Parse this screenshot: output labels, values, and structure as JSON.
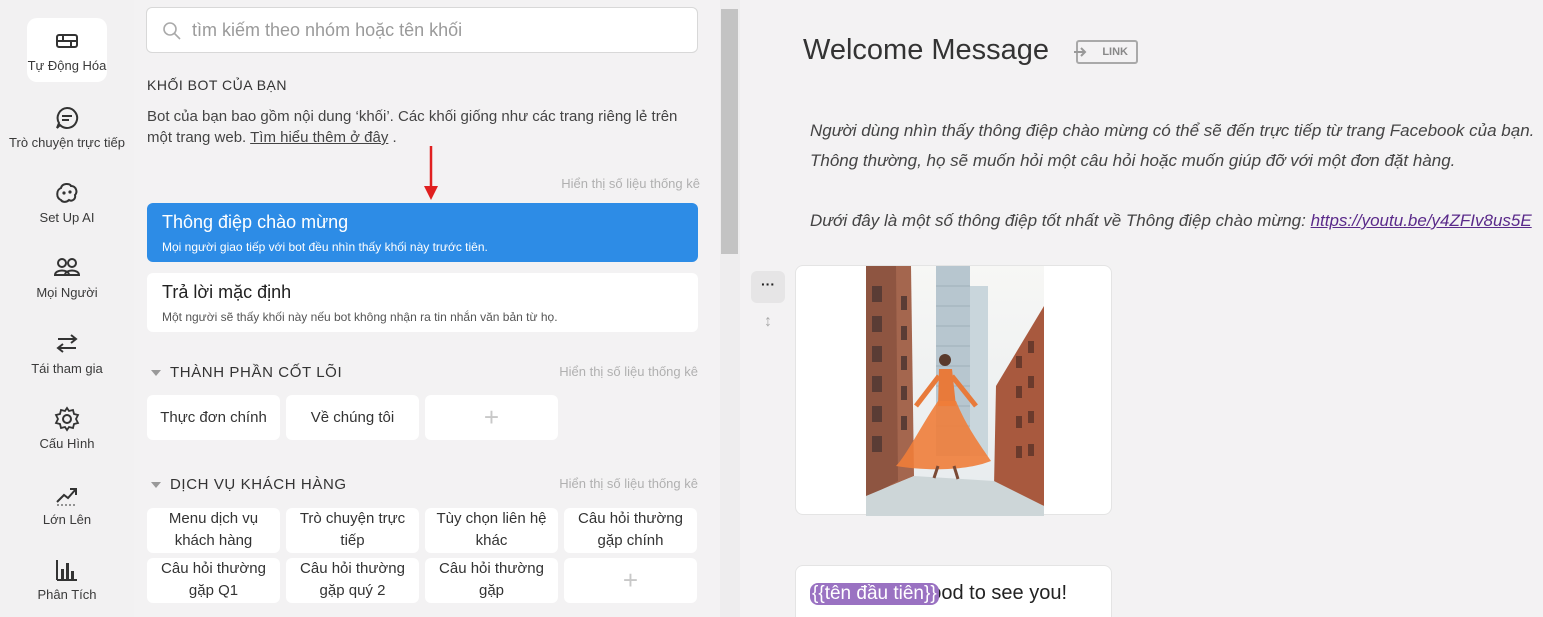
{
  "nav": {
    "items": [
      {
        "label": "Tự Động Hóa",
        "icon": "automation-icon"
      },
      {
        "label": "Trò chuyện trực tiếp",
        "icon": "chat-icon"
      },
      {
        "label": "Set Up AI",
        "icon": "ai-icon"
      },
      {
        "label": "Mọi Người",
        "icon": "people-icon"
      },
      {
        "label": "Tái tham gia",
        "icon": "reengage-icon"
      },
      {
        "label": "Cấu Hình",
        "icon": "gear-icon"
      },
      {
        "label": "Lớn Lên",
        "icon": "growth-icon"
      },
      {
        "label": "Phân Tích",
        "icon": "analytics-icon"
      }
    ]
  },
  "blocks": {
    "search_placeholder": "tìm kiếm theo nhóm hoặc tên khối",
    "heading": "KHỐI BOT CỦA BẠN",
    "desc_text": "Bot của bạn bao gồm nội dung ‘khối’. Các khối giống như các trang riêng lẻ trên một trang web.",
    "desc_link": "Tìm hiểu thêm ở đây",
    "desc_end": ".",
    "stats_label": "Hiển thị số liệu thống kê",
    "welcome": {
      "title": "Thông điệp chào mừng",
      "subtitle": "Mọi người giao tiếp với bot đều nhìn thấy khối này trước tiên."
    },
    "default_reply": {
      "title": "Trả lời mặc định",
      "subtitle": "Một người sẽ thấy khối này nếu bot không nhận ra tin nhắn văn bản từ họ."
    },
    "core": {
      "label": "THÀNH PHẦN CỐT LÕI",
      "tiles": [
        "Thực đơn chính",
        "Về chúng tôi"
      ]
    },
    "customer": {
      "label": "DỊCH VỤ KHÁCH HÀNG",
      "tiles": [
        "Menu dịch vụ khách hàng",
        "Trò chuyện trực tiếp",
        "Tùy chọn liên hệ khác",
        "Câu hỏi thường gặp chính",
        "Câu hỏi thường gặp Q1",
        "Câu hỏi thường gặp quý 2",
        "Câu hỏi thường gặp"
      ]
    },
    "add_symbol": "+"
  },
  "editor": {
    "title": "Welcome Message",
    "link_label": "LINK",
    "intro_line1": "Người dùng nhìn thấy thông điệp chào mừng có thể sẽ đến trực tiếp từ trang Facebook của bạn.",
    "intro_line2": "Thông thường, họ sẽ muốn hỏi một câu hỏi hoặc muốn giúp đỡ với một đơn đặt hàng.",
    "intro_line3": "Dưới đây là một số thông điệp tốt nhất về Thông điệp chào mừng:",
    "intro_url": "https://youtu.be/y4ZFIv8us5E",
    "menu_dots": "···",
    "drag_symbol": "↕",
    "chip": "{{tên đầu tiên}}",
    "message_rest": "Good to see you!"
  },
  "colors": {
    "accent": "#2d8ce6",
    "chip": "#9a72c2",
    "annotation_arrow": "#e02020",
    "link_purple": "#5a2a8a"
  }
}
